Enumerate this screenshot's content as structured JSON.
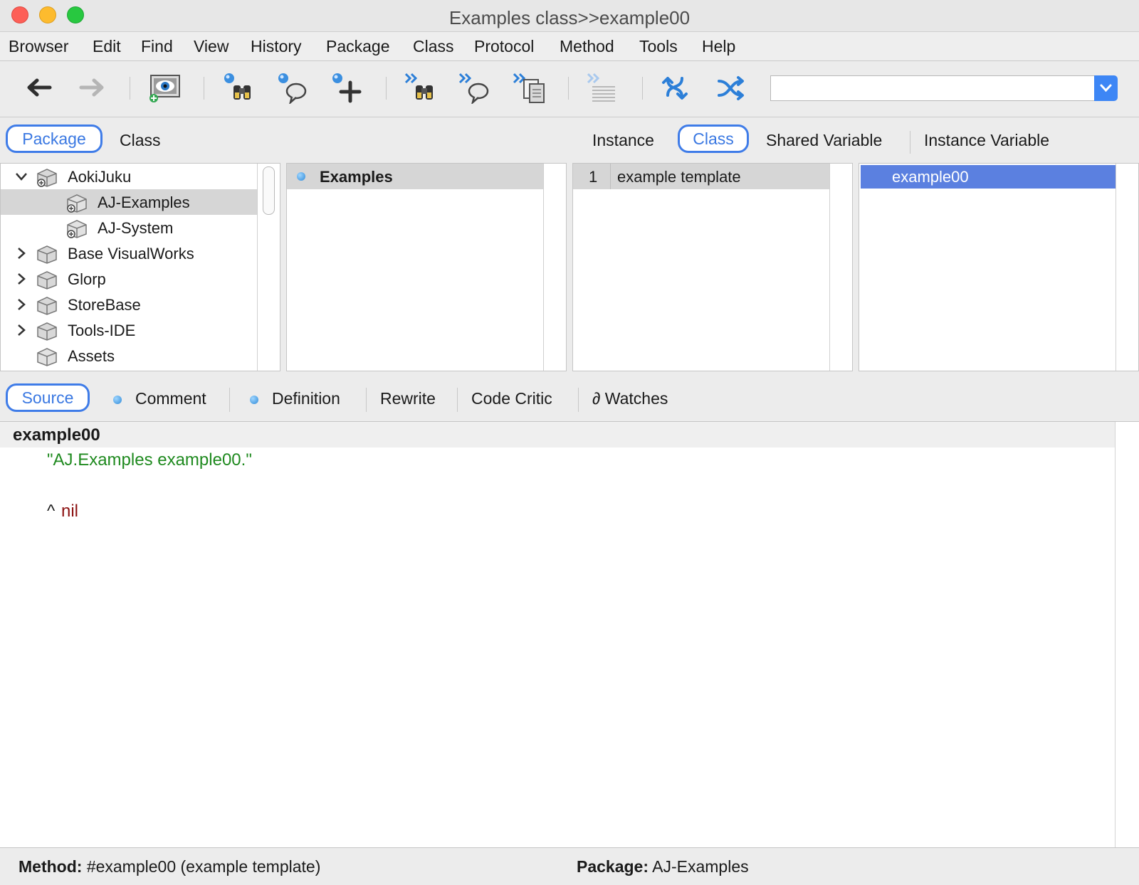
{
  "window": {
    "title": "Examples class>>example00"
  },
  "menu": [
    "Browser",
    "Edit",
    "Find",
    "View",
    "History",
    "Package",
    "Class",
    "Protocol",
    "Method",
    "Tools",
    "Help"
  ],
  "toolbar": {
    "icons": [
      "back-arrow-icon",
      "forward-arrow-icon",
      "inspect-eye-icon",
      "find-binoculars-icon",
      "senders-bubble-icon",
      "add-plus-icon",
      "implementors-binoculars-icon",
      "references-bubble-icon",
      "copy-pages-icon",
      "format-text-icon",
      "swap-icon",
      "shuffle-icon"
    ],
    "search_value": ""
  },
  "nav_tabs": {
    "package": "Package",
    "class": "Class",
    "instance": "Instance",
    "class_side": "Class",
    "shared_variable": "Shared Variable",
    "instance_variable": "Instance Variable"
  },
  "packages": [
    {
      "label": "AokiJuku",
      "expanded": true,
      "indent": 0
    },
    {
      "label": "AJ-Examples",
      "selected": true,
      "indent": 1
    },
    {
      "label": "AJ-System",
      "indent": 1
    },
    {
      "label": "Base VisualWorks",
      "collapsed": true,
      "indent": 0
    },
    {
      "label": "Glorp",
      "collapsed": true,
      "indent": 0
    },
    {
      "label": "StoreBase",
      "collapsed": true,
      "indent": 0
    },
    {
      "label": "Tools-IDE",
      "collapsed": true,
      "indent": 0
    },
    {
      "label": "Assets",
      "indent": 0
    }
  ],
  "classes": [
    {
      "label": "Examples"
    }
  ],
  "protocols": [
    {
      "count": "1",
      "label": "example template"
    }
  ],
  "methods": [
    {
      "label": "example00"
    }
  ],
  "code_tabs": {
    "source": "Source",
    "comment": "Comment",
    "definition": "Definition",
    "rewrite": "Rewrite",
    "code_critic": "Code Critic",
    "watches": "∂ Watches"
  },
  "code": {
    "method_name": "example00",
    "comment": "\"AJ.Examples example00.\"",
    "return_caret": "^",
    "return_value": "nil"
  },
  "status": {
    "method_key": "Method:",
    "method_value": "#example00 (example template)",
    "package_key": "Package:",
    "package_value": "AJ-Examples"
  },
  "colors": {
    "accent": "#3f7ce8",
    "selection": "#5b80e0",
    "comment": "#1f8a1f",
    "literal": "#8b1010"
  }
}
